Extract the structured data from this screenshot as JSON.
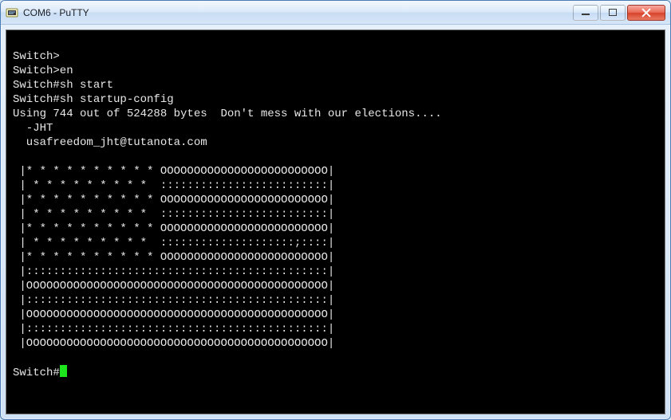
{
  "window": {
    "title": "COM6 - PuTTY"
  },
  "terminal": {
    "lines": [
      "",
      "Switch>",
      "Switch>en",
      "Switch#sh start",
      "Switch#sh startup-config",
      "Using 744 out of 524288 bytes  Don't mess with our elections....",
      "  -JHT",
      "  usafreedom_jht@tutanota.com",
      "",
      " |* * * * * * * * * * OOOOOOOOOOOOOOOOOOOOOOOOO|",
      " | * * * * * * * * *  :::::::::::::::::::::::::|",
      " |* * * * * * * * * * OOOOOOOOOOOOOOOOOOOOOOOOO|",
      " | * * * * * * * * *  :::::::::::::::::::::::::|",
      " |* * * * * * * * * * OOOOOOOOOOOOOOOOOOOOOOOOO|",
      " | * * * * * * * * *  ::::::::::::::::::::;::::|",
      " |* * * * * * * * * * OOOOOOOOOOOOOOOOOOOOOOOOO|",
      " |:::::::::::::::::::::::::::::::::::::::::::::|",
      " |OOOOOOOOOOOOOOOOOOOOOOOOOOOOOOOOOOOOOOOOOOOOO|",
      " |:::::::::::::::::::::::::::::::::::::::::::::|",
      " |OOOOOOOOOOOOOOOOOOOOOOOOOOOOOOOOOOOOOOOOOOOOO|",
      " |:::::::::::::::::::::::::::::::::::::::::::::|",
      " |OOOOOOOOOOOOOOOOOOOOOOOOOOOOOOOOOOOOOOOOOOOOO|",
      ""
    ],
    "prompt": "Switch#"
  }
}
